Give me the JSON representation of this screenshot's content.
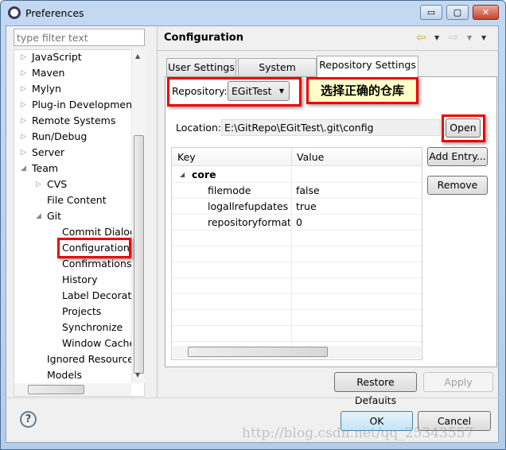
{
  "window": {
    "title": "Preferences",
    "minimize": "▭",
    "maximize": "▢",
    "close": "✕"
  },
  "sidebar": {
    "filter_placeholder": "type filter text",
    "items": [
      {
        "label": "JavaScript",
        "level": 0,
        "arrow": "▷"
      },
      {
        "label": "Maven",
        "level": 0,
        "arrow": "▷"
      },
      {
        "label": "Mylyn",
        "level": 0,
        "arrow": "▷"
      },
      {
        "label": "Plug-in Development",
        "level": 0,
        "arrow": "▷"
      },
      {
        "label": "Remote Systems",
        "level": 0,
        "arrow": "▷"
      },
      {
        "label": "Run/Debug",
        "level": 0,
        "arrow": "▷"
      },
      {
        "label": "Server",
        "level": 0,
        "arrow": "▷"
      },
      {
        "label": "Team",
        "level": 0,
        "arrow": "◢"
      },
      {
        "label": "CVS",
        "level": 1,
        "arrow": "▷"
      },
      {
        "label": "File Content",
        "level": 1,
        "arrow": ""
      },
      {
        "label": "Git",
        "level": 1,
        "arrow": "◢"
      },
      {
        "label": "Commit Dialog",
        "level": 2,
        "arrow": ""
      },
      {
        "label": "Configuration",
        "level": 2,
        "arrow": "",
        "selected": true
      },
      {
        "label": "Confirmations and Warnings",
        "level": 2,
        "arrow": ""
      },
      {
        "label": "History",
        "level": 2,
        "arrow": ""
      },
      {
        "label": "Label Decorations",
        "level": 2,
        "arrow": ""
      },
      {
        "label": "Projects",
        "level": 2,
        "arrow": ""
      },
      {
        "label": "Synchronize",
        "level": 2,
        "arrow": ""
      },
      {
        "label": "Window Cache",
        "level": 2,
        "arrow": ""
      },
      {
        "label": "Ignored Resources",
        "level": 1,
        "arrow": ""
      },
      {
        "label": "Models",
        "level": 1,
        "arrow": ""
      }
    ]
  },
  "page": {
    "title": "Configuration",
    "tabs": [
      {
        "label": "User Settings"
      },
      {
        "label": "System Settings"
      },
      {
        "label": "Repository Settings",
        "active": true
      }
    ],
    "repository_label": "Repository:",
    "repository_value": "EGitTest",
    "callout": "选择正确的仓库",
    "location_label": "Location:",
    "location_value": "E:\\GitRepo\\EGitTest\\.git\\config",
    "open_label": "Open",
    "add_entry_label": "Add Entry...",
    "remove_label": "Remove",
    "table": {
      "columns": [
        "Key",
        "Value"
      ],
      "section": "core",
      "rows": [
        {
          "key": "filemode",
          "value": "false"
        },
        {
          "key": "logallrefupdates",
          "value": "true"
        },
        {
          "key": "repositoryformatversion",
          "value": "0"
        }
      ]
    },
    "restore_defaults_label": "Restore Defaults",
    "apply_label": "Apply"
  },
  "footer": {
    "help": "?",
    "ok_label": "OK",
    "cancel_label": "Cancel"
  },
  "watermark": "http://blog.csdn.net/qq_25343557"
}
